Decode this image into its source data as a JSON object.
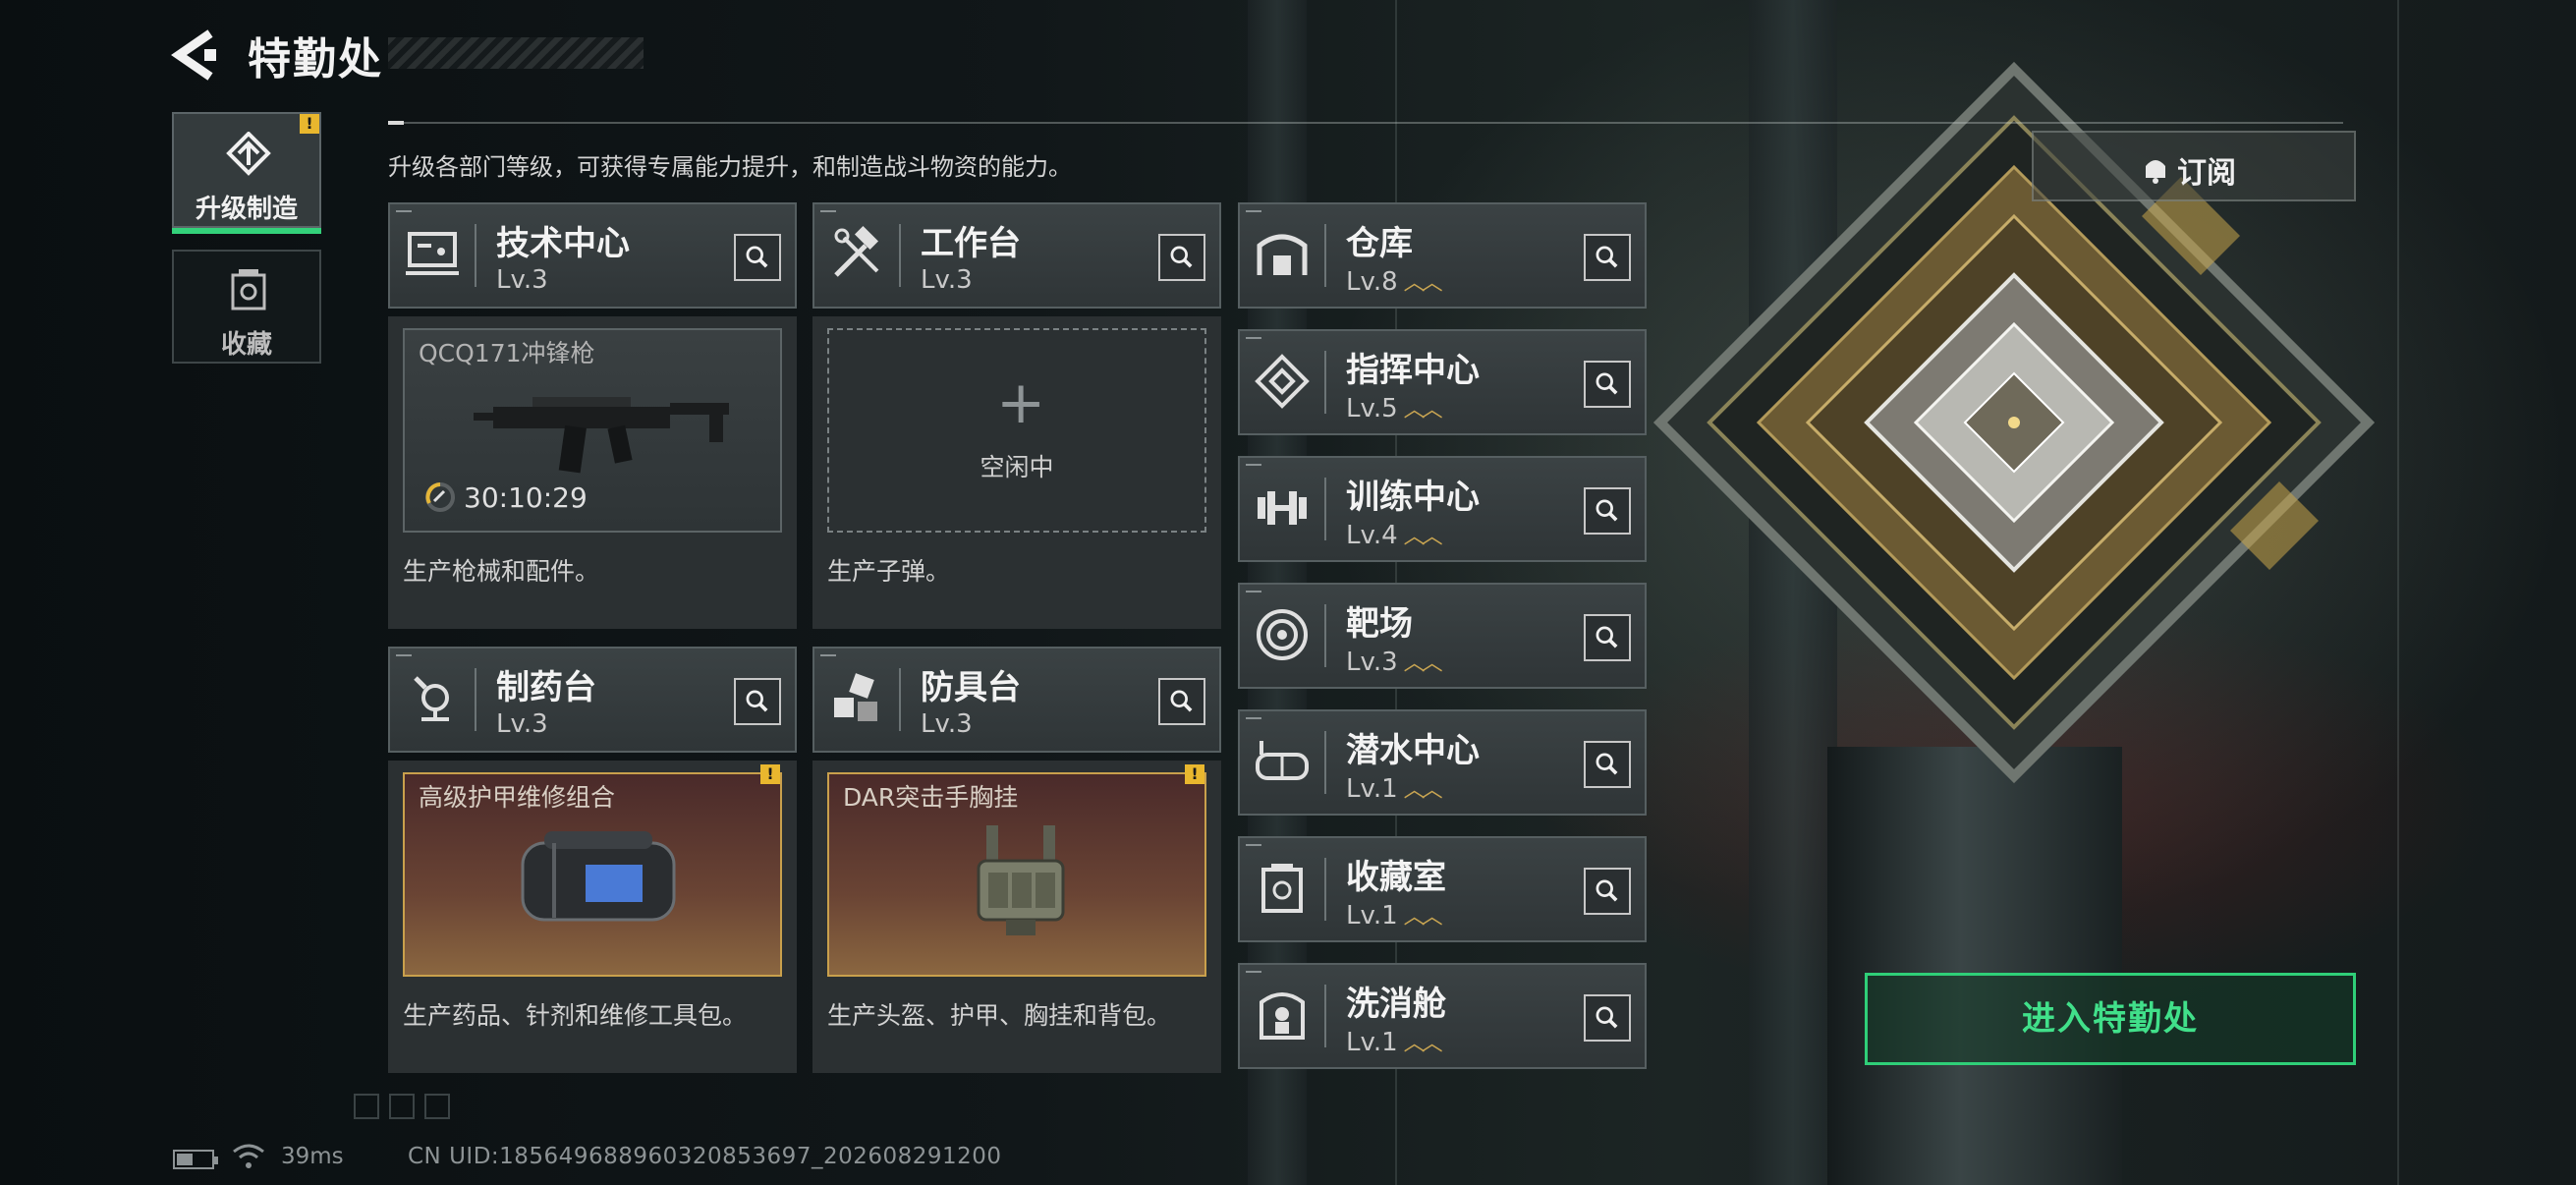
{
  "header": {
    "title": "特勤处"
  },
  "subtitle": "升级各部门等级，可获得专属能力提升，和制造战斗物资的能力。",
  "tabs": [
    {
      "label": "升级制造",
      "icon": "upgrade-icon",
      "active": true,
      "alert": "!"
    },
    {
      "label": "收藏",
      "icon": "collection-icon",
      "active": false
    }
  ],
  "workshops": [
    {
      "name": "技术中心",
      "level": "Lv.3",
      "icon": "tech-center-icon",
      "slot_label": "QCQ171冲锋枪",
      "timer": "30:10:29",
      "description": "生产枪械和配件。"
    },
    {
      "name": "工作台",
      "level": "Lv.3",
      "icon": "workbench-icon",
      "slot_status": "空闲中",
      "description": "生产子弹。"
    },
    {
      "name": "制药台",
      "level": "Lv.3",
      "icon": "pharmacy-icon",
      "slot_label": "高级护甲维修组合",
      "alert": "!",
      "description": "生产药品、针剂和维修工具包。"
    },
    {
      "name": "防具台",
      "level": "Lv.3",
      "icon": "armor-bench-icon",
      "slot_label": "DAR突击手胸挂",
      "alert": "!",
      "description": "生产头盔、护甲、胸挂和背包。"
    }
  ],
  "departments": [
    {
      "name": "仓库",
      "level": "Lv.8",
      "icon": "warehouse-icon"
    },
    {
      "name": "指挥中心",
      "level": "Lv.5",
      "icon": "command-center-icon"
    },
    {
      "name": "训练中心",
      "level": "Lv.4",
      "icon": "dumbbell-icon"
    },
    {
      "name": "靶场",
      "level": "Lv.3",
      "icon": "target-icon"
    },
    {
      "name": "潜水中心",
      "level": "Lv.1",
      "icon": "diving-mask-icon"
    },
    {
      "name": "收藏室",
      "level": "Lv.1",
      "icon": "collection-room-icon"
    },
    {
      "name": "洗消舱",
      "level": "Lv.1",
      "icon": "decontamination-icon"
    }
  ],
  "subscribe": {
    "label": "订阅"
  },
  "enter": {
    "label": "进入特勤处"
  },
  "footer": {
    "ping": "39ms",
    "uid": "CN UID:18564968896032085369​7_202608291200"
  },
  "colors": {
    "accent_green": "#33d17a",
    "alert_yellow": "#e9b72e",
    "level_chevron": "#c9a552"
  }
}
